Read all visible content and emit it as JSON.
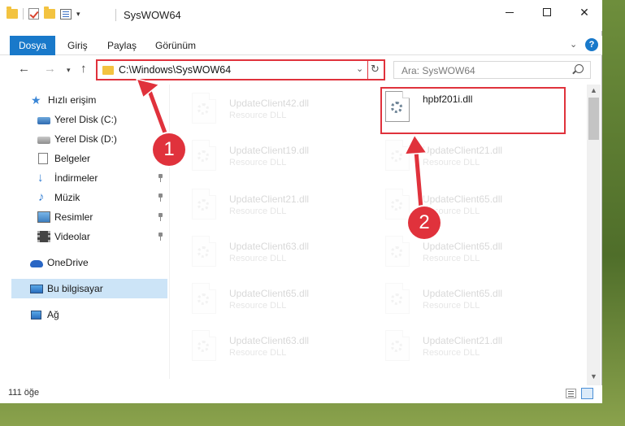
{
  "window": {
    "title": "SysWOW64",
    "controls": {
      "minimize": "minimize-icon",
      "maximize": "maximize-icon",
      "close": "✕"
    }
  },
  "ribbon": {
    "tabs": [
      {
        "label": "Dosya",
        "active": true
      },
      {
        "label": "Giriş"
      },
      {
        "label": "Paylaş"
      },
      {
        "label": "Görünüm"
      }
    ],
    "help": "?",
    "expand_icon": "chevron-down-icon"
  },
  "navigation": {
    "back": "←",
    "forward": "→",
    "recent": "▾",
    "up": "↑",
    "address": "C:\\Windows\\SysWOW64",
    "address_dropdown": "⌄",
    "refresh": "↻",
    "search_placeholder": "Ara: SysWOW64"
  },
  "sidebar": {
    "items": [
      {
        "label": "Hızlı erişim",
        "icon": "star-icon"
      },
      {
        "label": "Yerel Disk (C:)",
        "icon": "drive-icon",
        "pinned": true
      },
      {
        "label": "Yerel Disk (D:)",
        "icon": "drive-icon"
      },
      {
        "label": "Belgeler",
        "icon": "documents-icon",
        "pinned": true
      },
      {
        "label": "İndirmeler",
        "icon": "downloads-icon",
        "pinned": true
      },
      {
        "label": "Müzik",
        "icon": "music-icon",
        "pinned": true
      },
      {
        "label": "Resimler",
        "icon": "pictures-icon",
        "pinned": true
      },
      {
        "label": "Videolar",
        "icon": "videos-icon",
        "pinned": true
      },
      {
        "label": "OneDrive",
        "icon": "onedrive-icon"
      },
      {
        "label": "Bu bilgisayar",
        "icon": "this-pc-icon",
        "selected": true
      },
      {
        "label": "Ağ",
        "icon": "network-icon"
      }
    ]
  },
  "files": {
    "left_column": [
      {
        "name": "UpdateClient42.dll",
        "type": "Resource DLL"
      },
      {
        "name": "UpdateClient19.dll",
        "type": "Resource DLL"
      },
      {
        "name": "UpdateClient21.dll",
        "type": "Resource DLL"
      },
      {
        "name": "UpdateClient63.dll",
        "type": "Resource DLL"
      },
      {
        "name": "UpdateClient65.dll",
        "type": "Resource DLL"
      },
      {
        "name": "UpdateClient63.dll",
        "type": "Resource DLL"
      }
    ],
    "right_column": [
      {
        "name": "hpbf201i.dll",
        "type": "",
        "highlighted": true
      },
      {
        "name": "UpdateClient21.dll",
        "type": "Resource DLL"
      },
      {
        "name": "UpdateClient65.dll",
        "type": "Resource DLL"
      },
      {
        "name": "UpdateClient65.dll",
        "type": "Resource DLL"
      },
      {
        "name": "UpdateClient65.dll",
        "type": "Resource DLL"
      },
      {
        "name": "UpdateClient21.dll",
        "type": "Resource DLL"
      }
    ]
  },
  "scrollbar": {
    "up": "▲",
    "down": "▼"
  },
  "status": {
    "item_count": "111 öğe"
  },
  "annotations": [
    {
      "number": "1"
    },
    {
      "number": "2"
    }
  ],
  "colors": {
    "accent": "#1979ca",
    "annotation": "#e0323c",
    "selection": "#cce4f7"
  }
}
